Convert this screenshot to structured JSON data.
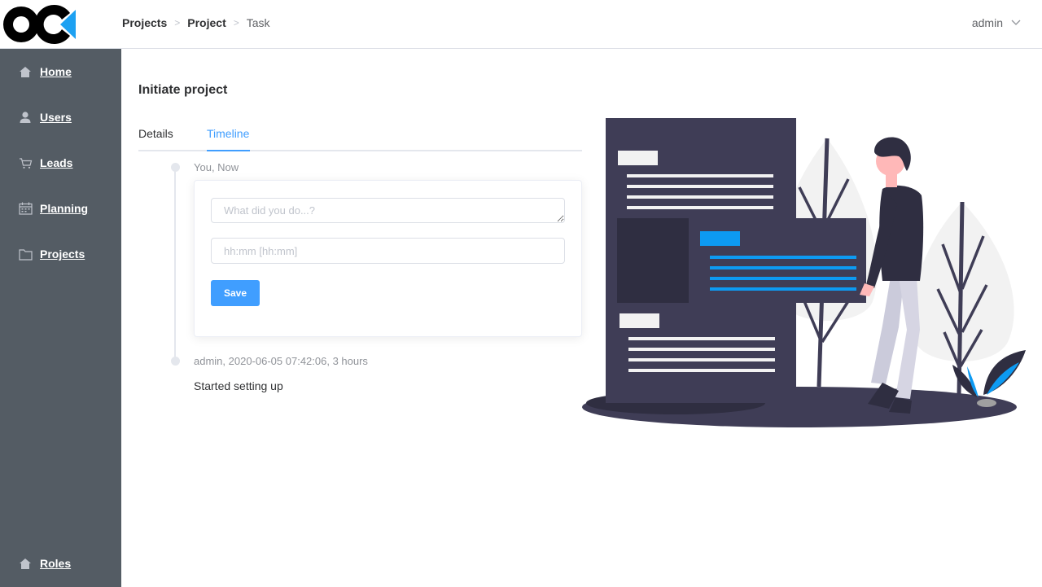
{
  "header": {
    "breadcrumb": [
      "Projects",
      "Project",
      "Task"
    ],
    "user": "admin"
  },
  "sidebar": {
    "items": [
      {
        "label": "Home",
        "icon": "home-icon"
      },
      {
        "label": "Users",
        "icon": "user-icon"
      },
      {
        "label": "Leads",
        "icon": "cart-icon"
      },
      {
        "label": "Planning",
        "icon": "calendar-icon"
      },
      {
        "label": "Projects",
        "icon": "folder-icon"
      }
    ],
    "bottom_item": {
      "label": "Roles",
      "icon": "home-icon"
    }
  },
  "main": {
    "title": "Initiate project",
    "tabs": [
      {
        "label": "Details",
        "active": false
      },
      {
        "label": "Timeline",
        "active": true
      }
    ],
    "timeline": {
      "entries": [
        {
          "meta": "You, Now"
        },
        {
          "meta": "admin, 2020-06-05 07:42:06, 3 hours",
          "content": "Started setting up"
        }
      ],
      "form": {
        "activity_placeholder": "What did you do...?",
        "time_placeholder": "hh:mm [hh:mm]",
        "save_label": "Save"
      }
    }
  },
  "colors": {
    "sidebar_bg": "#545c64",
    "accent": "#409eff",
    "illustration_dark": "#3f3d56",
    "illustration_blue": "#0d9af2"
  }
}
